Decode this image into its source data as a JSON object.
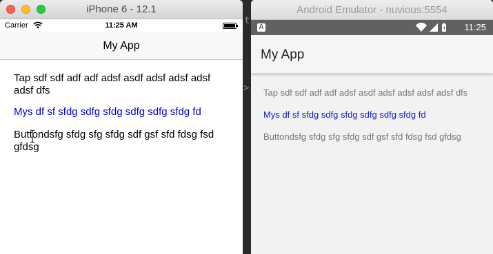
{
  "ios": {
    "window_title": "iPhone 6 - 12.1",
    "status": {
      "carrier": "Carrier",
      "time": "11:25 AM"
    },
    "nav_title": "My App",
    "label_text": "Tap sdf sdf adf adf adsf asdf adsf adsf adsf adsf dfs",
    "link_text": "Mys df sf sfdg sdfg sfdg sdfg sdfg sfdg fd",
    "button_label_text": "Buttondsfg sfdg sfg sfdg sdf gsf sfd fdsg fsd gfdsg"
  },
  "android": {
    "window_title": "Android Emulator - nuvious:5554",
    "status": {
      "notification_icon": "A",
      "time": "11:25"
    },
    "app_title": "My App",
    "label_text": "Tap sdf sdf adf adf adsf asdf adsf adsf adsf adsf dfs",
    "link_text": "Mys df sf sfdg sdfg sfdg sdfg sdfg sfdg fd",
    "button_label_text": "Buttondsfg sfdg sfg sfdg sdf gsf sfd fdsg fsd gfdsg"
  },
  "background_glyphs": {
    "t": "t",
    "chevron": ">"
  },
  "colors": {
    "ios_link": "#0000cc",
    "android_link": "#1a1ac8",
    "android_status_bar": "#616161"
  },
  "icons": [
    "wifi-icon",
    "battery-icon",
    "signal-icon",
    "text-cursor-icon"
  ]
}
